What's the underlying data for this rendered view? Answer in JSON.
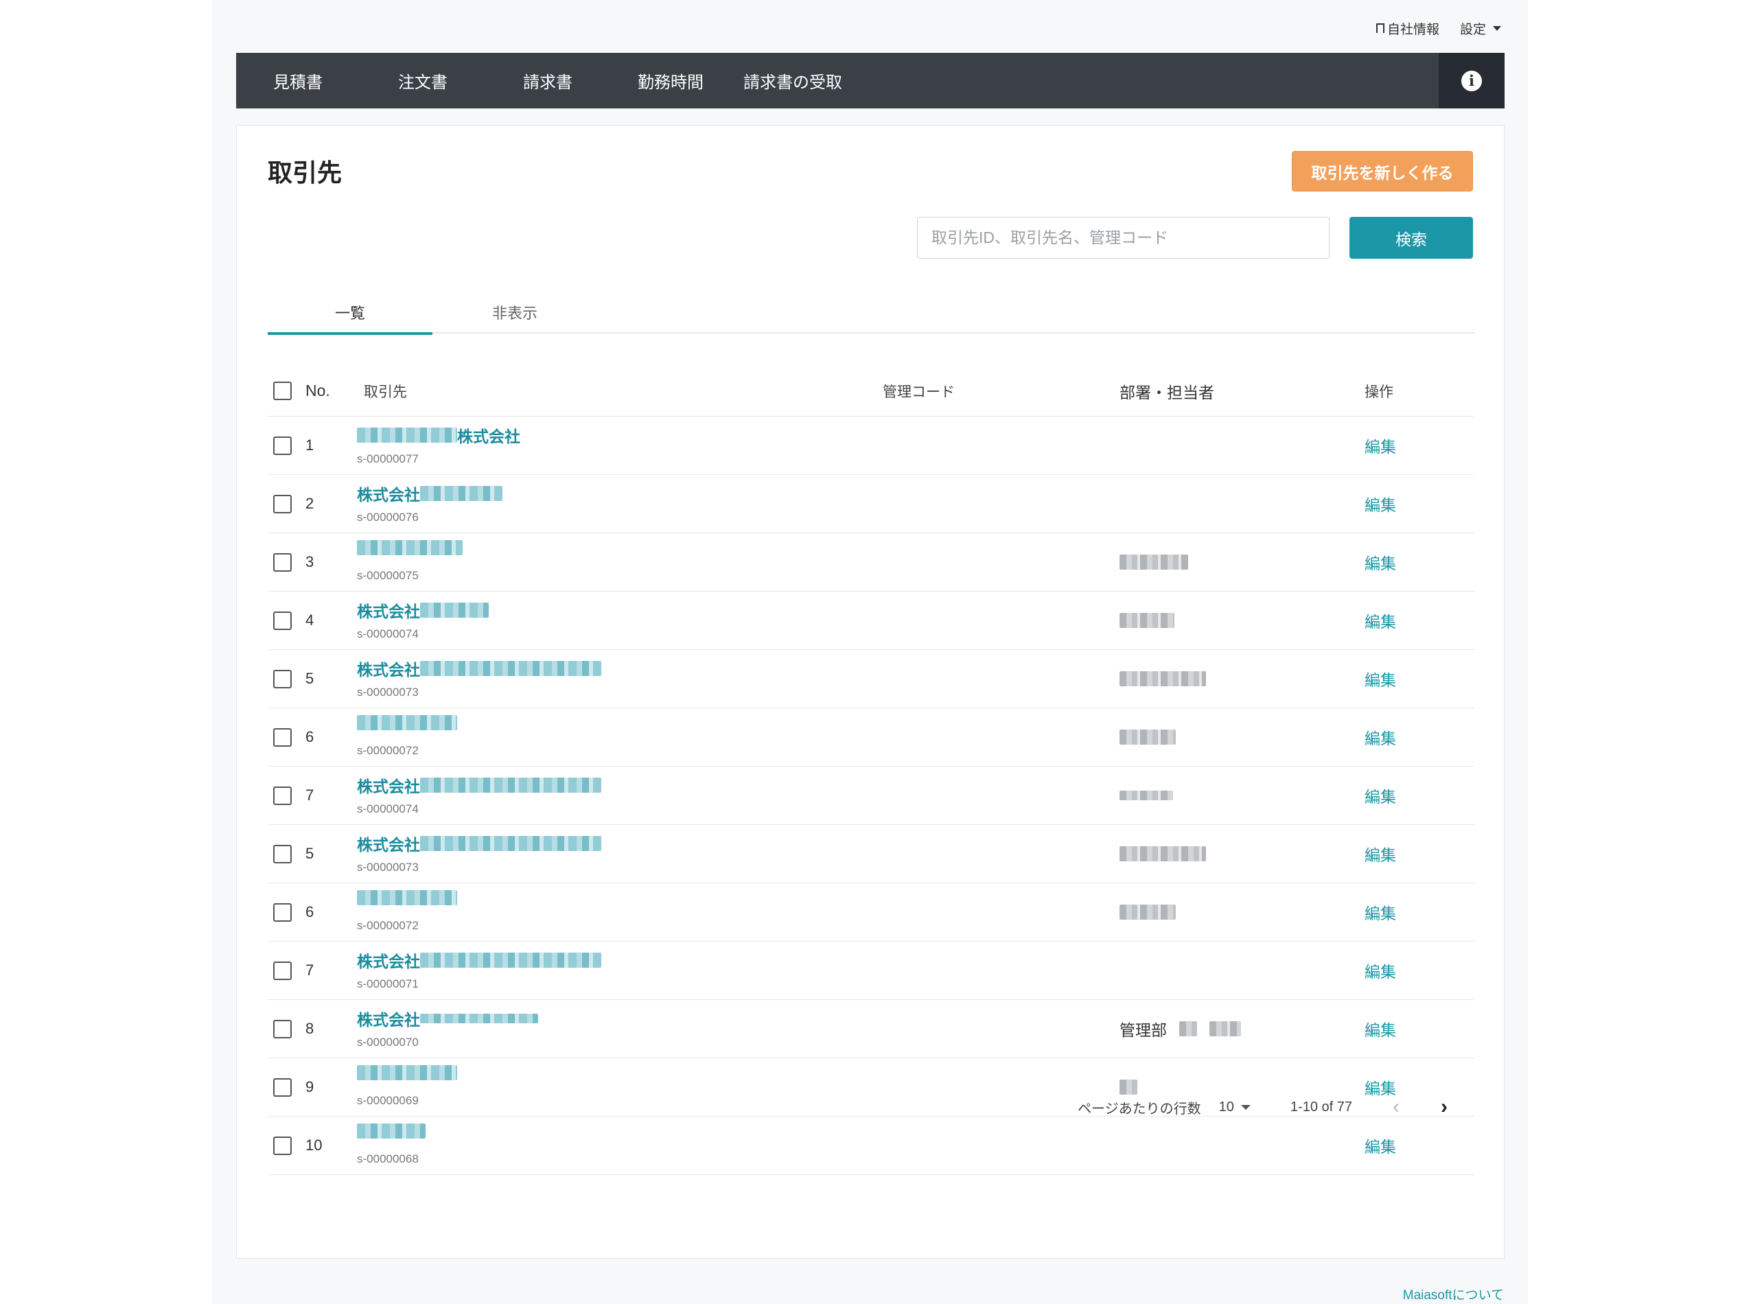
{
  "topbar": {
    "company_info": "自社情報",
    "settings": "設定"
  },
  "nav": {
    "items": [
      "見積書",
      "注文書",
      "請求書",
      "勤務時間",
      "請求書の受取"
    ]
  },
  "page": {
    "title": "取引先",
    "new_button": "取引先を新しく作る",
    "search_placeholder": "取引先ID、取引先名、管理コード",
    "search_button": "検索"
  },
  "tabs": [
    "一覧",
    "非表示"
  ],
  "table": {
    "headers": {
      "no": "No.",
      "name": "取引先",
      "code": "管理コード",
      "dept": "部署・担当者",
      "op": "操作"
    },
    "rows": [
      {
        "no": "1",
        "prefix": "",
        "suffix": "株式会社",
        "id": "s-00000077",
        "dept_text": "",
        "op": "編集"
      },
      {
        "no": "2",
        "prefix": "株式会社",
        "suffix": "",
        "id": "s-00000076",
        "dept_text": "",
        "op": "編集"
      },
      {
        "no": "3",
        "prefix": "",
        "suffix": "",
        "id": "s-00000075",
        "dept_text": "",
        "op": "編集"
      },
      {
        "no": "4",
        "prefix": "株式会社",
        "suffix": "",
        "id": "s-00000074",
        "dept_text": "",
        "op": "編集"
      },
      {
        "no": "5",
        "prefix": "株式会社",
        "suffix": "",
        "id": "s-00000073",
        "dept_text": "",
        "op": "編集"
      },
      {
        "no": "6",
        "prefix": "",
        "suffix": "",
        "id": "s-00000072",
        "dept_text": "",
        "op": "編集"
      },
      {
        "no": "7",
        "prefix": "株式会社",
        "suffix": "",
        "id": "s-00000074",
        "dept_text": "",
        "op": "編集"
      },
      {
        "no": "5",
        "prefix": "株式会社",
        "suffix": "",
        "id": "s-00000073",
        "dept_text": "",
        "op": "編集"
      },
      {
        "no": "6",
        "prefix": "",
        "suffix": "",
        "id": "s-00000072",
        "dept_text": "",
        "op": "編集"
      },
      {
        "no": "7",
        "prefix": "株式会社",
        "suffix": "",
        "id": "s-00000071",
        "dept_text": "",
        "op": "編集"
      },
      {
        "no": "8",
        "prefix": "株式会社",
        "suffix": "",
        "id": "s-00000070",
        "dept_text": "管理部",
        "op": "編集"
      },
      {
        "no": "9",
        "prefix": "",
        "suffix": "",
        "id": "s-00000069",
        "dept_text": "",
        "op": "編集"
      },
      {
        "no": "10",
        "prefix": "",
        "suffix": "",
        "id": "s-00000068",
        "dept_text": "",
        "op": "編集"
      }
    ]
  },
  "pager": {
    "rows_per_page_label": "ページあたりの行数",
    "rows_per_page": "10",
    "range": "1-10 of 77"
  },
  "footer": {
    "about": "Maiasoftについて"
  },
  "colors": {
    "accent": "#1b97a8",
    "new_button": "#f3a05a",
    "navbar": "#3b3f46"
  }
}
